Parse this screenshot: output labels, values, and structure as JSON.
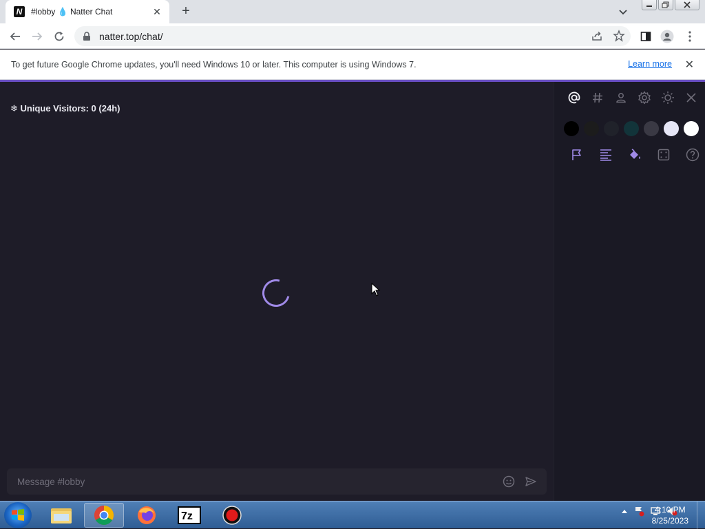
{
  "browser": {
    "tab_title": "#lobby 💧 Natter Chat",
    "favicon_letter": "N",
    "url": "natter.top/chat/",
    "infobar_text": "To get future Google Chrome updates, you'll need Windows 10 or later. This computer is using Windows 7.",
    "infobar_link": "Learn more"
  },
  "app": {
    "visitors_text": "❄ Unique Visitors: 0 (24h)",
    "message_placeholder": "Message #lobby",
    "accent_color": "#a08ae8",
    "swatch_colors": [
      "#000000",
      "#1c1c1c",
      "#20222a",
      "#12343a",
      "#3a3944",
      "#e6e6f6",
      "#ffffff"
    ],
    "sidebar_top_icons": [
      "at-icon",
      "hash-icon",
      "user-icon",
      "gear-icon",
      "sun-icon",
      "close-icon"
    ],
    "sidebar_tool_icons": [
      "flag-icon",
      "align-left-icon",
      "paint-bucket-icon",
      "dice-icon",
      "help-icon"
    ]
  },
  "taskbar": {
    "time": "4:10 PM",
    "date": "8/25/2023",
    "apps": [
      "file-explorer",
      "chrome",
      "firefox",
      "7zip",
      "recorder"
    ]
  }
}
